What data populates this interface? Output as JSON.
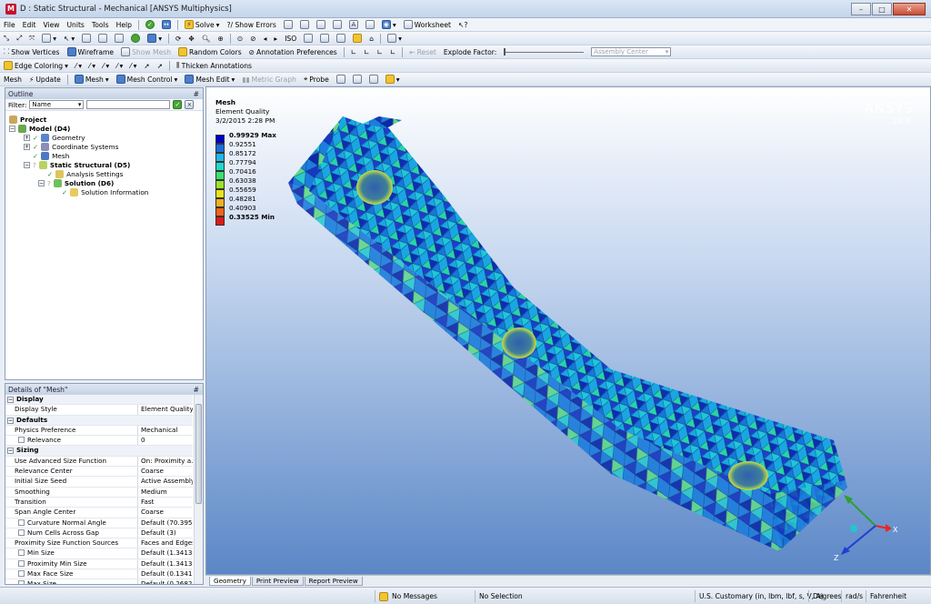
{
  "window": {
    "title": "D : Static Structural - Mechanical [ANSYS Multiphysics]",
    "app_badge": "M",
    "minimize": "–",
    "maximize": "□",
    "close": "✕"
  },
  "menu": [
    "File",
    "Edit",
    "View",
    "Units",
    "Tools",
    "Help"
  ],
  "toolbar1": {
    "solve": "Solve",
    "show_errors": "?/ Show Errors",
    "worksheet": "Worksheet"
  },
  "toolbar2": {
    "show_vertices": "Show Vertices",
    "wireframe": "Wireframe",
    "show_mesh": "Show Mesh",
    "random_colors": "Random Colors",
    "annotation_prefs": "Annotation Preferences",
    "reset": "Reset",
    "explode_factor": "Explode Factor:",
    "assembly_center": "Assembly Center"
  },
  "toolbar3": {
    "edge_coloring": "Edge Coloring",
    "thicken": "Thicken Annotations"
  },
  "context": {
    "mesh": "Mesh",
    "update": "Update",
    "mesh_menu": "Mesh",
    "mesh_control": "Mesh Control",
    "mesh_edit": "Mesh Edit",
    "metric_graph": "Metric Graph",
    "probe": "Probe"
  },
  "outline": {
    "header": "Outline",
    "pin": "#",
    "filter_label": "Filter:",
    "filter_value": "Name",
    "tree": [
      {
        "label": "Project",
        "bold": true
      },
      {
        "label": "Model (D4)",
        "bold": true
      },
      {
        "label": "Geometry",
        "bold": false
      },
      {
        "label": "Coordinate Systems",
        "bold": false
      },
      {
        "label": "Mesh",
        "bold": false
      },
      {
        "label": "Static Structural (D5)",
        "bold": true
      },
      {
        "label": "Analysis Settings",
        "bold": false
      },
      {
        "label": "Solution (D6)",
        "bold": true
      },
      {
        "label": "Solution Information",
        "bold": false
      }
    ]
  },
  "details": {
    "header": "Details of \"Mesh\"",
    "pin": "#",
    "rows": [
      {
        "type": "sec",
        "k": "Display",
        "v": ""
      },
      {
        "type": "row",
        "k": "Display Style",
        "v": "Element Quality"
      },
      {
        "type": "sec",
        "k": "Defaults",
        "v": ""
      },
      {
        "type": "row",
        "k": "Physics Preference",
        "v": "Mechanical"
      },
      {
        "type": "sub",
        "k": "Relevance",
        "v": "0"
      },
      {
        "type": "sec",
        "k": "Sizing",
        "v": ""
      },
      {
        "type": "row",
        "k": "Use Advanced Size Function",
        "v": "On: Proximity a..."
      },
      {
        "type": "row",
        "k": "Relevance Center",
        "v": "Coarse"
      },
      {
        "type": "row",
        "k": "Initial Size Seed",
        "v": "Active Assembly"
      },
      {
        "type": "row",
        "k": "Smoothing",
        "v": "Medium"
      },
      {
        "type": "row",
        "k": "Transition",
        "v": "Fast"
      },
      {
        "type": "row",
        "k": "Span Angle Center",
        "v": "Coarse"
      },
      {
        "type": "sub",
        "k": "Curvature Normal Angle",
        "v": "Default (70.395..."
      },
      {
        "type": "sub",
        "k": "Num Cells Across Gap",
        "v": "Default (3)"
      },
      {
        "type": "row",
        "k": "Proximity Size Function Sources",
        "v": "Faces and Edges"
      },
      {
        "type": "sub",
        "k": "Min Size",
        "v": "Default (1.3413..."
      },
      {
        "type": "sub",
        "k": "Proximity Min Size",
        "v": "Default (1.3413..."
      },
      {
        "type": "sub",
        "k": "Max Face Size",
        "v": "Default (0.1341..."
      },
      {
        "type": "sub",
        "k": "Max Size",
        "v": "Default (0.2682..."
      }
    ]
  },
  "viewport": {
    "heading": "Mesh",
    "subtitle": "Element Quality",
    "date": "3/2/2015 2:28 PM",
    "brand": "ANSYS",
    "version": "16.0"
  },
  "legend": {
    "labels": [
      "0.99929 Max",
      "0.92551",
      "0.85172",
      "0.77794",
      "0.70416",
      "0.63038",
      "0.55659",
      "0.48281",
      "0.40903",
      "0.33525 Min"
    ],
    "colors": [
      "#0000c8",
      "#1a6de0",
      "#1fb6e8",
      "#20d8c8",
      "#38e070",
      "#9be22a",
      "#e6e21d",
      "#f2b01a",
      "#f0641a",
      "#e01818"
    ]
  },
  "triad": {
    "x": "X",
    "y": "Y",
    "z": "Z"
  },
  "tabs": [
    "Geometry",
    "Print Preview",
    "Report Preview"
  ],
  "status": {
    "messages": "No Messages",
    "selection": "No Selection",
    "units": "U.S. Customary (in, lbm, lbf, s, V, A)",
    "angle": "Degrees",
    "rate": "rad/s",
    "temp": "Fahrenheit"
  }
}
